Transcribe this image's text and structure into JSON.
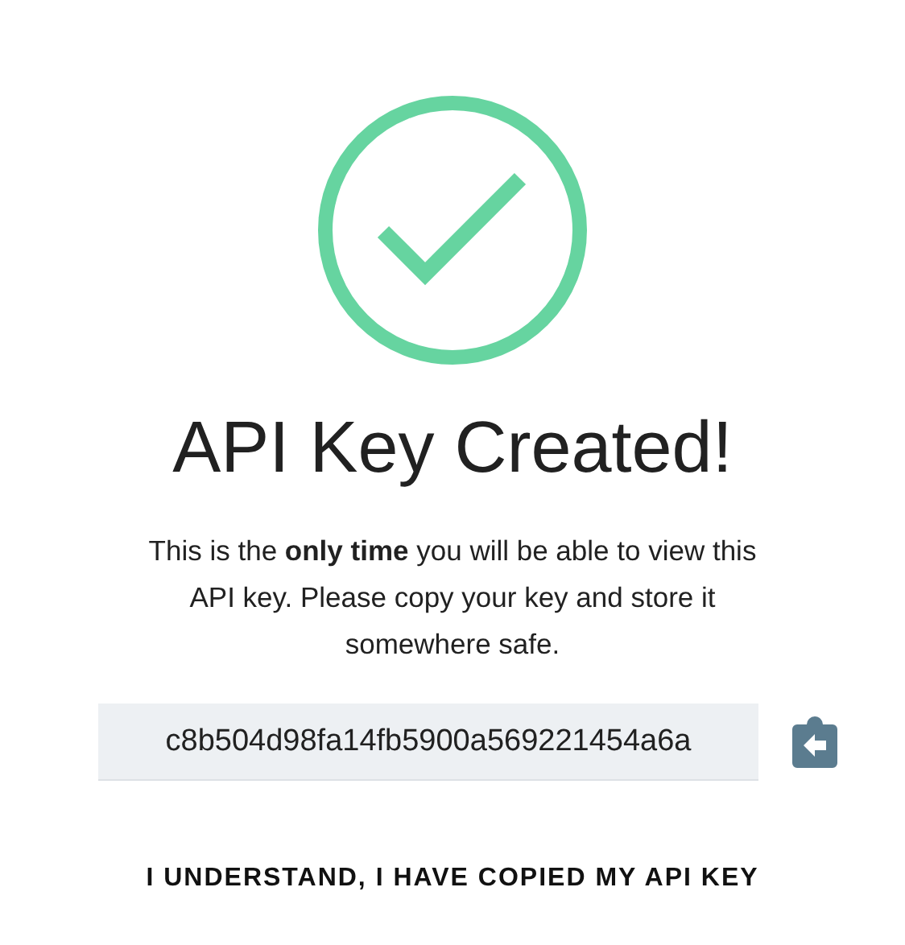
{
  "title": "API Key Created!",
  "message": "This is the **only time** you will be able to view this API key. Please copy your key and store it somewhere safe.",
  "api_key": {
    "value": "c8b504d98fa14fb5900a569221454a6a"
  },
  "confirm_button": "I UNDERSTAND, I HAVE COPIED MY API KEY"
}
